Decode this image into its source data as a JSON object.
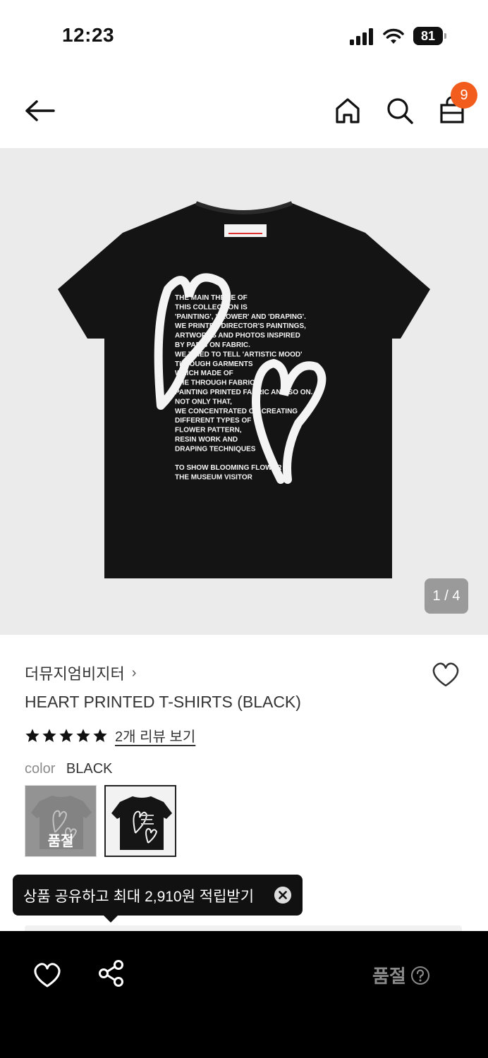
{
  "status_bar": {
    "time": "12:23",
    "battery": "81",
    "battery_level": 0.81,
    "icons": [
      "signal-icon",
      "wifi-icon",
      "battery-icon"
    ]
  },
  "nav": {
    "icons": [
      "back-arrow-icon",
      "home-icon",
      "search-icon",
      "shopping-bag-icon"
    ],
    "cart_count": "9",
    "badge_color": "#f25c1c"
  },
  "gallery": {
    "counter": "1 / 4",
    "current_index": 1,
    "total_images": 4,
    "print_text": [
      "THE MAIN THEME OF",
      "THIS COLLECTION IS",
      "'PAINTING', 'FLOWER' AND 'DRAPING'.",
      "WE PRINTED DIRECTOR'S PAINTINGS,",
      "ARTWORKS AND PHOTOS INSPIRED",
      "BY PARIS ON FABRIC.",
      "WE TRIED TO TELL 'ARTISTIC MOOD'",
      "THROUGH GARMENTS",
      "WHICH MADE OF",
      "THE THROUGH FABRIC,",
      "PAINTING PRINTED FABRIC AND SO ON.",
      "NOT ONLY THAT,",
      "WE CONCENTRATED ON CREATING",
      "DIFFERENT TYPES OF",
      "FLOWER PATTERN,",
      "RESIN WORK AND",
      "DRAPING TECHNIQUES",
      "",
      "TO SHOW BLOOMING FLOWER",
      "THE MUSEUM VISITOR"
    ]
  },
  "product": {
    "brand": "더뮤지엄비지터",
    "brand_chevron": "›",
    "title": "HEART PRINTED T-SHIRTS (BLACK)",
    "rating": 5,
    "review_link": "2개 리뷰 보기",
    "option_label": "color",
    "option_value": "BLACK",
    "swatches": [
      {
        "name": "grey-variant",
        "status": "품절"
      },
      {
        "name": "black-variant",
        "status": ""
      }
    ]
  },
  "tooltip": {
    "text": "상품 공유하고 최대 2,910원 적립받기"
  },
  "bottom_bar": {
    "soldout_label": "품절",
    "icons": [
      "heart-icon",
      "share-icon",
      "help-icon"
    ]
  }
}
